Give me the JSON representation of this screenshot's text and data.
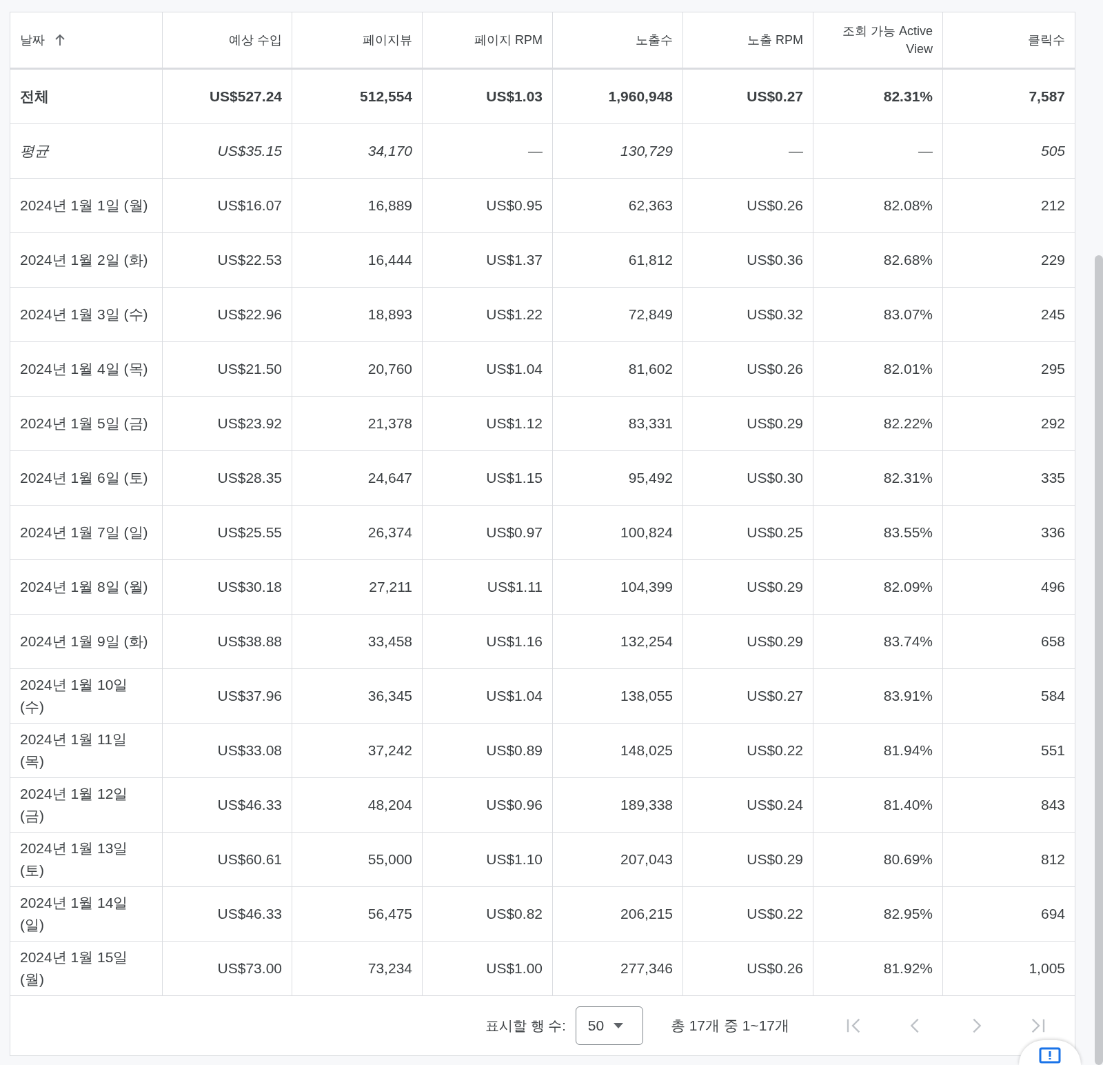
{
  "table": {
    "columns": [
      {
        "label": "날짜",
        "sort_ascending": true
      },
      {
        "label": "예상 수입"
      },
      {
        "label": "페이지뷰"
      },
      {
        "label": "페이지 RPM"
      },
      {
        "label": "노출수"
      },
      {
        "label": "노출 RPM"
      },
      {
        "label": "조회 가능 Active View"
      },
      {
        "label": "클릭수"
      }
    ],
    "rows": [
      {
        "kind": "total",
        "cells": [
          "전체",
          "US$527.24",
          "512,554",
          "US$1.03",
          "1,960,948",
          "US$0.27",
          "82.31%",
          "7,587"
        ]
      },
      {
        "kind": "average",
        "cells": [
          "평균",
          "US$35.15",
          "34,170",
          "—",
          "130,729",
          "—",
          "—",
          "505"
        ]
      },
      {
        "kind": "day",
        "cells": [
          "2024년 1월 1일 (월)",
          "US$16.07",
          "16,889",
          "US$0.95",
          "62,363",
          "US$0.26",
          "82.08%",
          "212"
        ]
      },
      {
        "kind": "day",
        "cells": [
          "2024년 1월 2일 (화)",
          "US$22.53",
          "16,444",
          "US$1.37",
          "61,812",
          "US$0.36",
          "82.68%",
          "229"
        ]
      },
      {
        "kind": "day",
        "cells": [
          "2024년 1월 3일 (수)",
          "US$22.96",
          "18,893",
          "US$1.22",
          "72,849",
          "US$0.32",
          "83.07%",
          "245"
        ]
      },
      {
        "kind": "day",
        "cells": [
          "2024년 1월 4일 (목)",
          "US$21.50",
          "20,760",
          "US$1.04",
          "81,602",
          "US$0.26",
          "82.01%",
          "295"
        ]
      },
      {
        "kind": "day",
        "cells": [
          "2024년 1월 5일 (금)",
          "US$23.92",
          "21,378",
          "US$1.12",
          "83,331",
          "US$0.29",
          "82.22%",
          "292"
        ]
      },
      {
        "kind": "day",
        "cells": [
          "2024년 1월 6일 (토)",
          "US$28.35",
          "24,647",
          "US$1.15",
          "95,492",
          "US$0.30",
          "82.31%",
          "335"
        ]
      },
      {
        "kind": "day",
        "cells": [
          "2024년 1월 7일 (일)",
          "US$25.55",
          "26,374",
          "US$0.97",
          "100,824",
          "US$0.25",
          "83.55%",
          "336"
        ]
      },
      {
        "kind": "day",
        "cells": [
          "2024년 1월 8일 (월)",
          "US$30.18",
          "27,211",
          "US$1.11",
          "104,399",
          "US$0.29",
          "82.09%",
          "496"
        ]
      },
      {
        "kind": "day",
        "cells": [
          "2024년 1월 9일 (화)",
          "US$38.88",
          "33,458",
          "US$1.16",
          "132,254",
          "US$0.29",
          "83.74%",
          "658"
        ]
      },
      {
        "kind": "day",
        "cells": [
          "2024년 1월 10일 (수)",
          "US$37.96",
          "36,345",
          "US$1.04",
          "138,055",
          "US$0.27",
          "83.91%",
          "584"
        ]
      },
      {
        "kind": "day",
        "cells": [
          "2024년 1월 11일 (목)",
          "US$33.08",
          "37,242",
          "US$0.89",
          "148,025",
          "US$0.22",
          "81.94%",
          "551"
        ]
      },
      {
        "kind": "day",
        "cells": [
          "2024년 1월 12일 (금)",
          "US$46.33",
          "48,204",
          "US$0.96",
          "189,338",
          "US$0.24",
          "81.40%",
          "843"
        ]
      },
      {
        "kind": "day",
        "cells": [
          "2024년 1월 13일 (토)",
          "US$60.61",
          "55,000",
          "US$1.10",
          "207,043",
          "US$0.29",
          "80.69%",
          "812"
        ]
      },
      {
        "kind": "day",
        "cells": [
          "2024년 1월 14일 (일)",
          "US$46.33",
          "56,475",
          "US$0.82",
          "206,215",
          "US$0.22",
          "82.95%",
          "694"
        ]
      },
      {
        "kind": "day",
        "cells": [
          "2024년 1월 15일 (월)",
          "US$73.00",
          "73,234",
          "US$1.00",
          "277,346",
          "US$0.26",
          "81.92%",
          "1,005"
        ]
      }
    ]
  },
  "pagination": {
    "rows_label": "표시할 행 수:",
    "rows_value": "50",
    "range": "총 17개 중 1~17개",
    "buttons": [
      {
        "kind": "first",
        "disabled": true
      },
      {
        "kind": "prev",
        "disabled": true
      },
      {
        "kind": "next",
        "disabled": true
      },
      {
        "kind": "last",
        "disabled": true
      }
    ]
  }
}
